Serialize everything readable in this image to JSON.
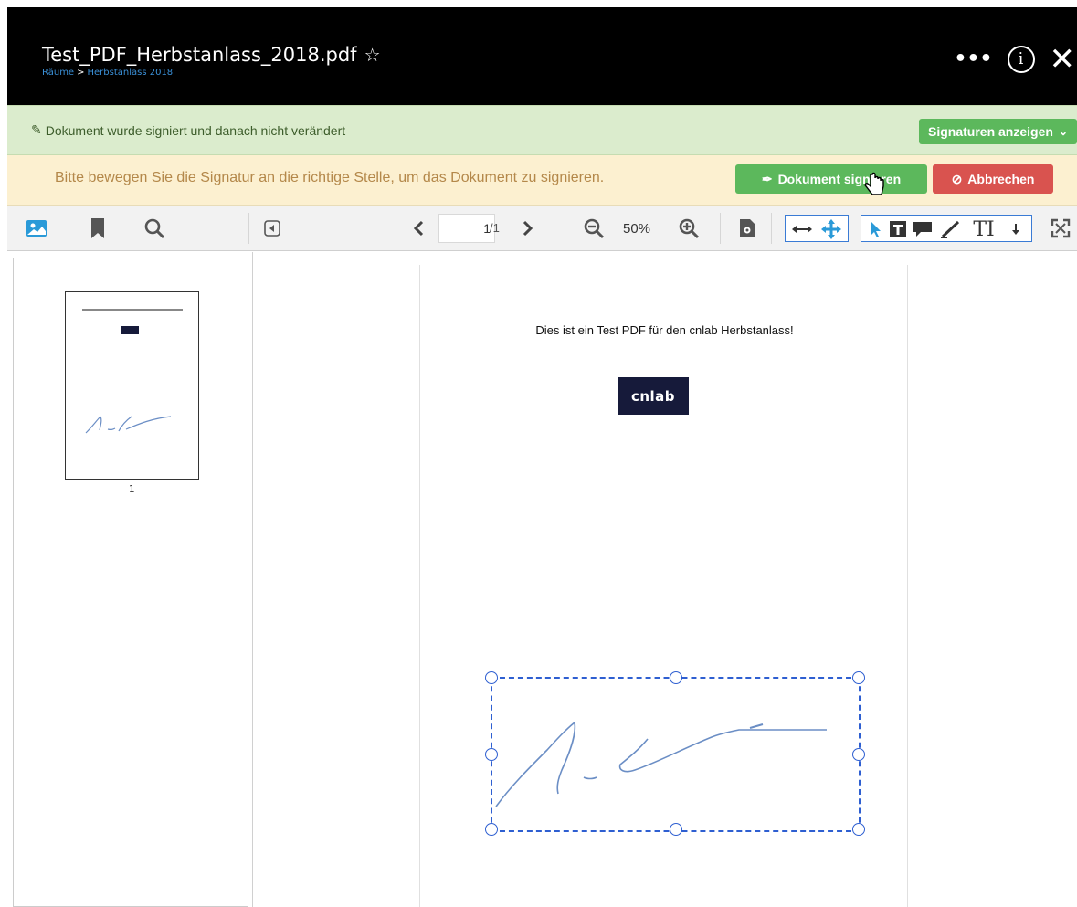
{
  "header": {
    "title": "Test_PDF_Herbstanlass_2018.pdf",
    "star_icon": "star-outline-icon",
    "breadcrumb": [
      "Räume",
      "Herbstanlass 2018"
    ],
    "breadcrumb_separator": ">",
    "actions": [
      "more-icon",
      "info-icon",
      "close-icon"
    ]
  },
  "success_bar": {
    "text": "Dokument wurde signiert und danach nicht verändert",
    "button_label": "Signaturen anzeigen",
    "color": "#dbeccd"
  },
  "warning_bar": {
    "text": "Bitte bewegen Sie die Signatur an die richtige Stelle, um das Dokument zu signieren.",
    "sign_button_label": "Dokument signieren",
    "cancel_button_label": "Abbrechen",
    "color": "#fcf0d0"
  },
  "toolbar": {
    "page_value": "1",
    "page_total": "/1",
    "zoom_level": "50%",
    "icons": [
      "thumbnail-icon",
      "bookmark-icon",
      "search-icon",
      "sidebar-toggle-icon",
      "prev-page-icon",
      "next-page-icon",
      "zoom-out-icon",
      "zoom-in-icon",
      "settings-page-icon",
      "fit-width-icon",
      "pan-icon",
      "select-arrow-icon",
      "text-annotation-icon",
      "comment-icon",
      "draw-icon",
      "text-tool-icon",
      "fullscreen-icon"
    ]
  },
  "thumbnails": {
    "page_label": "1"
  },
  "document": {
    "text": "Dies ist ein Test PDF für den cnlab Herbstanlass!",
    "logo_text": "cnlab"
  },
  "colors": {
    "accent_blue": "#2e5fd1",
    "green": "#5cb85c",
    "red": "#d9534f",
    "header_bg": "#000000"
  }
}
